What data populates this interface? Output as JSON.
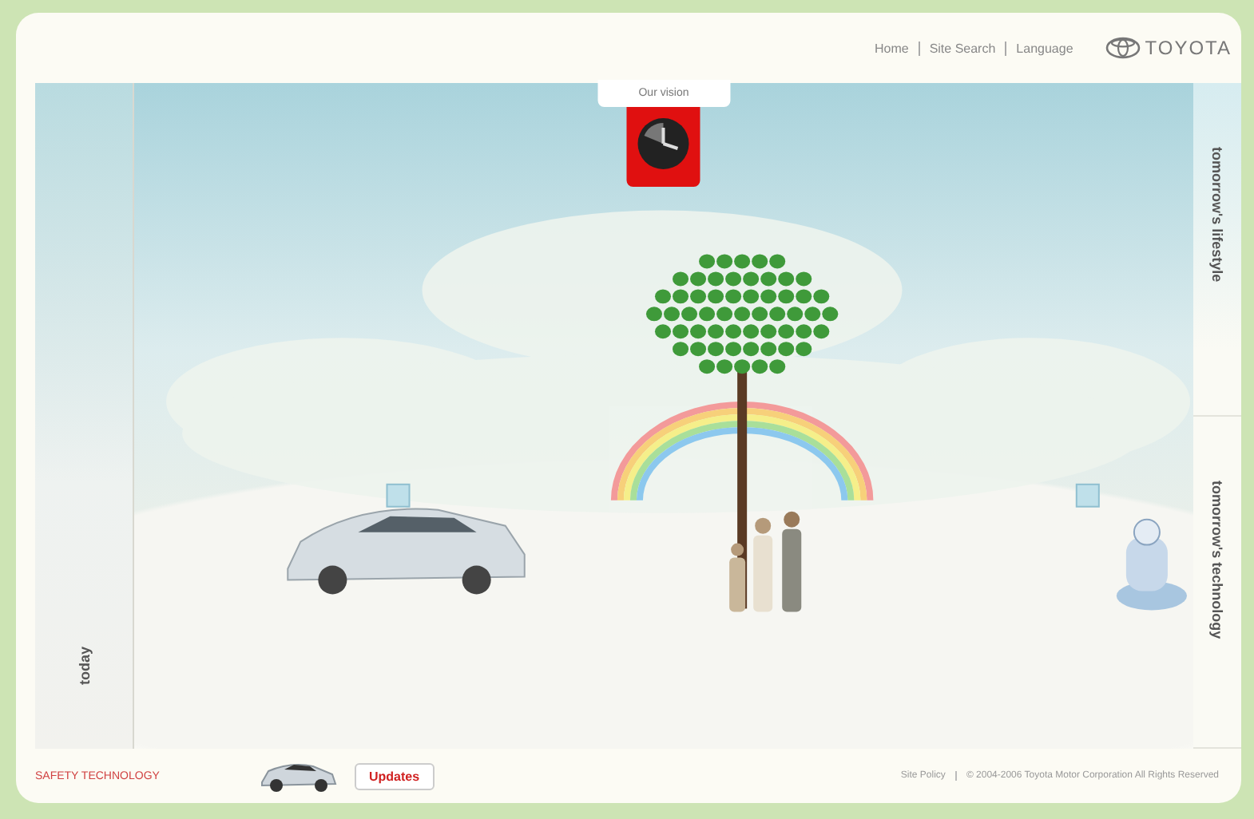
{
  "header": {
    "links": [
      "Home",
      "Site Search",
      "Language"
    ],
    "logo": "TOYOTA"
  },
  "clock_tab": {
    "label": "Our vision"
  },
  "side_tabs": [
    {
      "label": "tomorrow's lifestyle"
    },
    {
      "label": "tomorrow's technology"
    }
  ],
  "left_tab": {
    "label": "today"
  },
  "footer": {
    "link": "SAFETY TECHNOLOGY",
    "button": "Updates",
    "policy": "Site Policy",
    "copyright": "© 2004-2006 Toyota Motor Corporation All Rights Reserved"
  }
}
